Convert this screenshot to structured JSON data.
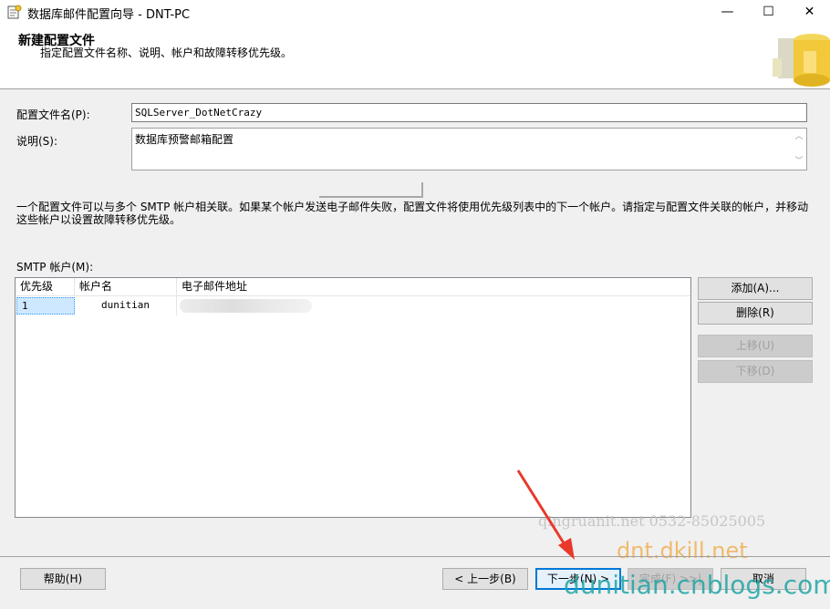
{
  "window": {
    "title": "数据库邮件配置向导 - DNT-PC",
    "minimize_glyph": "—",
    "maximize_glyph": "☐",
    "close_glyph": "✕"
  },
  "header": {
    "title": "新建配置文件",
    "subtitle": "指定配置文件名称、说明、帐户和故障转移优先级。"
  },
  "form": {
    "profile_name_label": "配置文件名(P):",
    "profile_name_value": "SQLServer_DotNetCrazy",
    "description_label": "说明(S):",
    "description_value": "数据库预警邮箱配置",
    "info_text": "一个配置文件可以与多个 SMTP 帐户相关联。如果某个帐户发送电子邮件失败，配置文件将使用优先级列表中的下一个帐户。请指定与配置文件关联的帐户，并移动这些帐户以设置故障转移优先级。",
    "smtp_label": "SMTP 帐户(M):"
  },
  "table": {
    "columns": [
      "优先级",
      "帐户名",
      "电子邮件地址"
    ],
    "rows": [
      {
        "priority": "1",
        "account": "dunitian",
        "email": ""
      }
    ]
  },
  "side_buttons": {
    "add": "添加(A)...",
    "delete": "删除(R)",
    "move_up": "上移(U)",
    "move_down": "下移(D)"
  },
  "bottom_buttons": {
    "help": "帮助(H)",
    "back": "< 上一步(B)",
    "next": "下一步(N) >",
    "finish": "完成(F) >>|",
    "cancel": "取消"
  },
  "watermarks": {
    "site1": "qingruanit.net 0532-85025005",
    "site2": "dnt.dkill.net",
    "site3": "dunitian.cnblogs.com"
  },
  "colors": {
    "accent": "#0078d7",
    "arrow": "#e8392b"
  }
}
